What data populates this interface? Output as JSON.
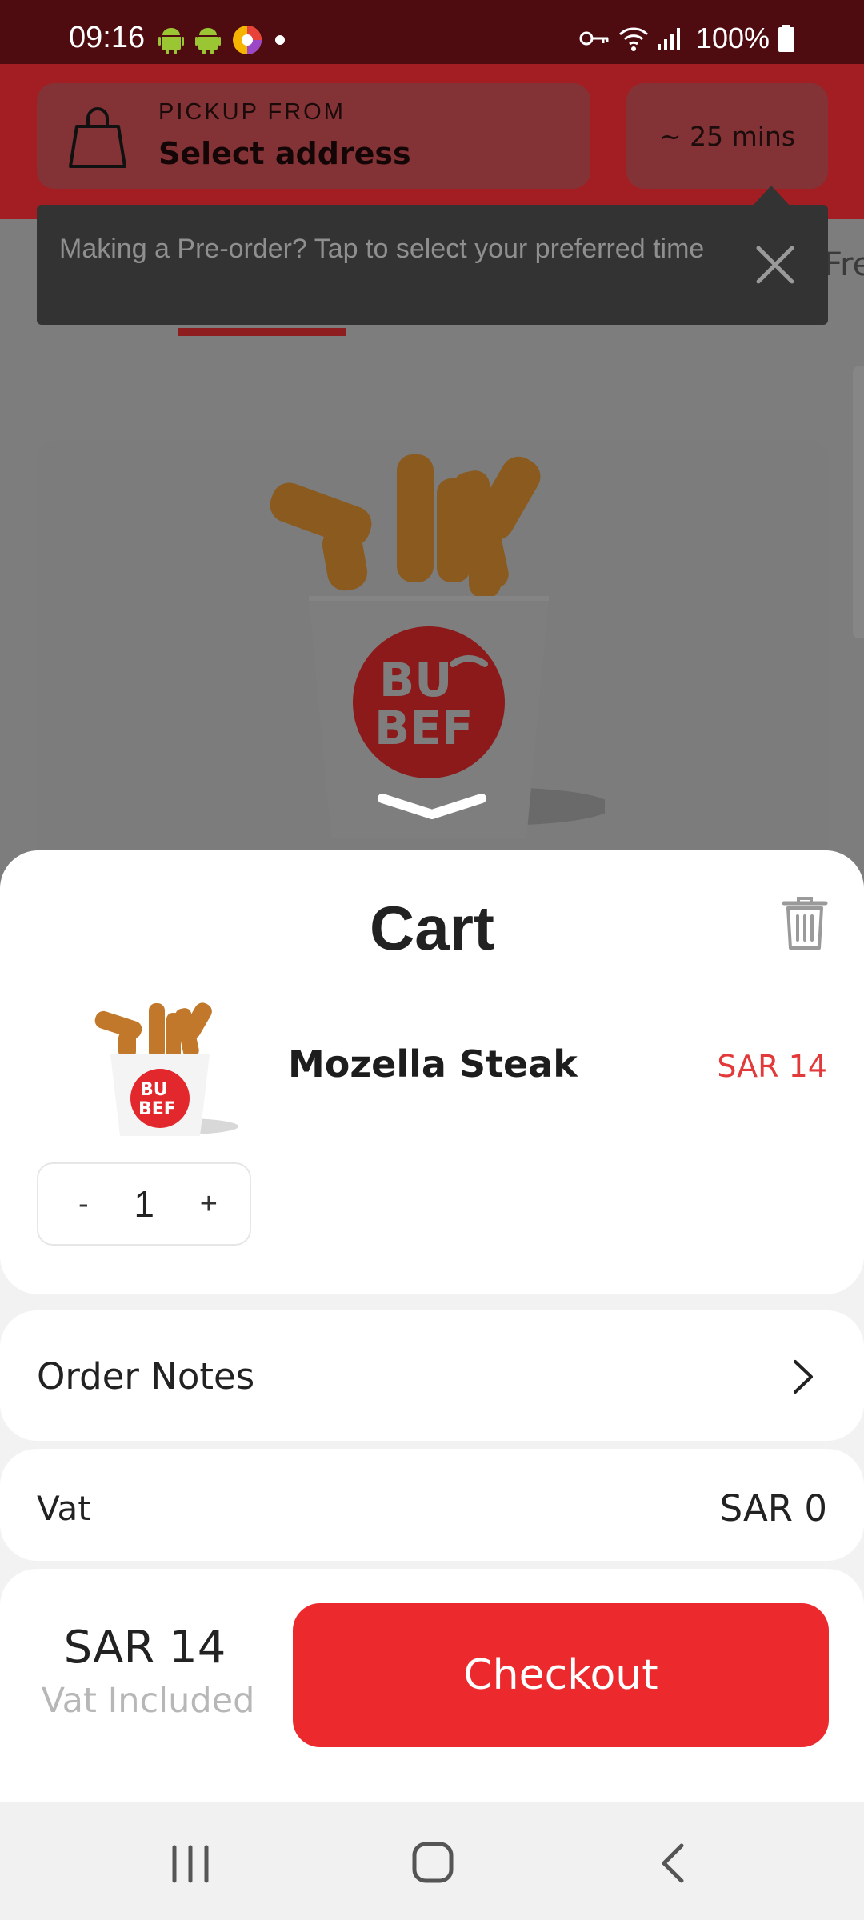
{
  "status_bar": {
    "time": "09:16",
    "left_icons": [
      "android-icon",
      "android-icon",
      "app-icon",
      "dot-icon"
    ],
    "right_icons": [
      "key-icon",
      "wifi-icon",
      "signal-icon",
      "battery-icon"
    ],
    "battery": "100%"
  },
  "header": {
    "pickup_label": "PICKUP FROM",
    "pickup_value": "Select address",
    "eta": "~ 25 mins"
  },
  "tooltip": {
    "text": "Making a Pre-order? Tap to select your preferred time"
  },
  "background": {
    "tab_peek": "Fre"
  },
  "cart": {
    "title": "Cart",
    "items": [
      {
        "name": "Mozella Steak",
        "price": "SAR 14",
        "quantity": "1",
        "decrement": "-",
        "increment": "+"
      }
    ],
    "order_notes_label": "Order Notes",
    "vat_label": "Vat",
    "vat_value": "SAR 0",
    "total": "SAR 14",
    "total_note": "Vat Included",
    "checkout_label": "Checkout"
  },
  "colors": {
    "brand_red": "#ec2a2e",
    "price_red": "#e23a3a",
    "status_bar": "#4f0c10"
  }
}
